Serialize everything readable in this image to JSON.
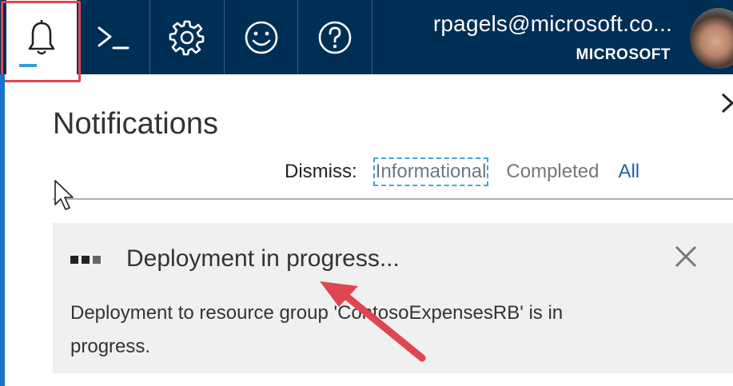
{
  "topbar": {
    "buttons": [
      {
        "name": "notifications-button",
        "icon": "bell-icon",
        "active": true
      },
      {
        "name": "cloud-shell-button",
        "icon": "terminal-icon"
      },
      {
        "name": "settings-button",
        "icon": "gear-icon"
      },
      {
        "name": "feedback-button",
        "icon": "smiley-icon"
      },
      {
        "name": "help-button",
        "icon": "question-icon"
      }
    ],
    "user_name": "rpagels@microsoft.co...",
    "user_org": "MICROSOFT",
    "avatar": "user-avatar"
  },
  "panel": {
    "title": "Notifications",
    "close_icon": "chevron-right-icon",
    "dismiss_label": "Dismiss:",
    "dismiss_options": [
      "Informational",
      "Completed",
      "All"
    ]
  },
  "notification": {
    "status_icon": "progress-dots-icon",
    "title": "Deployment in progress...",
    "body": "Deployment to resource group 'ContosoExpensesRB' is in progress.",
    "close_icon": "close-icon"
  },
  "colors": {
    "topbar": "#002f56",
    "accent": "#1a73c9",
    "highlight": "#e0464f",
    "card": "#f0f0f0"
  }
}
